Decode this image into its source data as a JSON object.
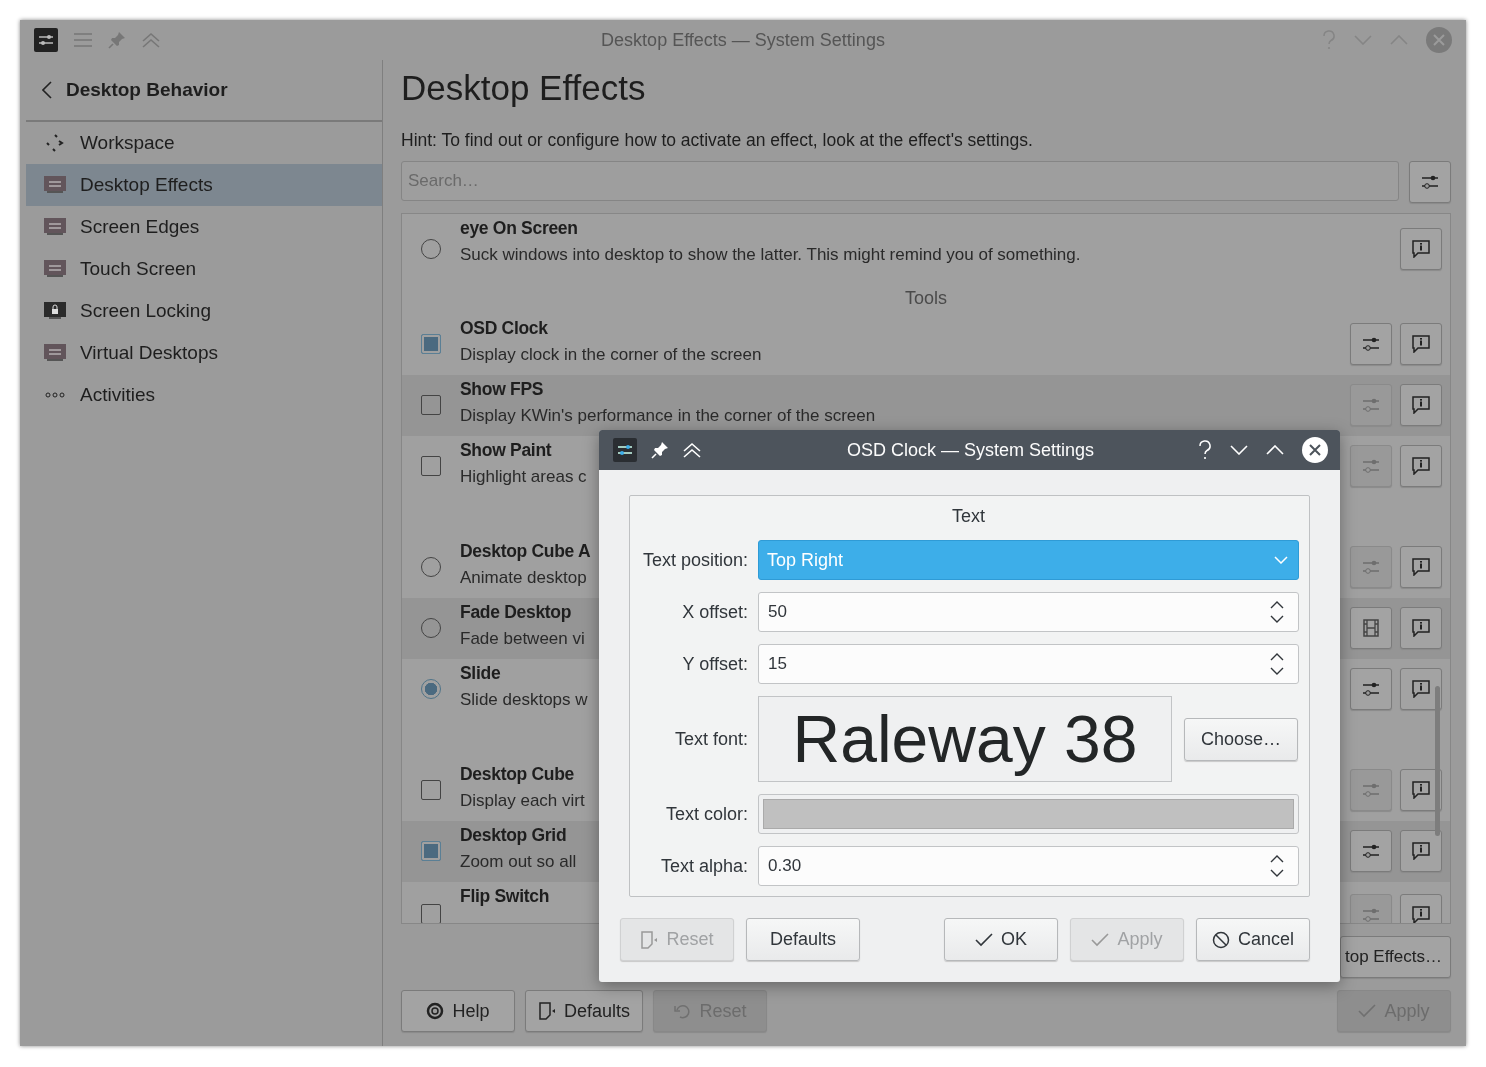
{
  "window": {
    "title": "Desktop Effects — System Settings"
  },
  "sidebar": {
    "header": "Desktop Behavior",
    "items": [
      {
        "label": "Workspace",
        "selected": false
      },
      {
        "label": "Desktop Effects",
        "selected": true
      },
      {
        "label": "Screen Edges",
        "selected": false
      },
      {
        "label": "Touch Screen",
        "selected": false
      },
      {
        "label": "Screen Locking",
        "selected": false
      },
      {
        "label": "Virtual Desktops",
        "selected": false
      },
      {
        "label": "Activities",
        "selected": false
      }
    ]
  },
  "page": {
    "title": "Desktop Effects",
    "hint": "Hint: To find out or configure how to activate an effect, look at the effect's settings.",
    "search": {
      "placeholder": "Search…"
    }
  },
  "effects": [
    {
      "kind": "radio",
      "checked": false,
      "title": "eye On Screen",
      "description": "Suck windows into desktop to show the latter. This might remind you of something."
    },
    {
      "kind": "section",
      "title": "Tools"
    },
    {
      "kind": "checkbox",
      "checked": true,
      "title": "OSD Clock",
      "description": "Display clock in the corner of the screen",
      "configure": {
        "kind": "settings",
        "enabled": true
      }
    },
    {
      "kind": "checkbox",
      "checked": false,
      "title": "Show FPS",
      "description": "Display KWin's performance in the corner of the screen",
      "configure": {
        "kind": "settings",
        "enabled": false
      }
    },
    {
      "kind": "checkbox",
      "checked": false,
      "title": "Show Paint",
      "description": "Highlight areas c",
      "configure": {
        "kind": "settings",
        "enabled": false
      }
    },
    {
      "kind": "spacer"
    },
    {
      "kind": "radio",
      "checked": false,
      "title": "Desktop Cube A",
      "description": "Animate desktop",
      "configure": {
        "kind": "settings",
        "enabled": false
      }
    },
    {
      "kind": "radio",
      "checked": false,
      "title": "Fade Desktop",
      "description": "Fade between vi",
      "configure": {
        "kind": "video",
        "enabled": true
      }
    },
    {
      "kind": "radio",
      "checked": true,
      "title": "Slide",
      "description": "Slide desktops w",
      "configure": {
        "kind": "settings",
        "enabled": true
      }
    },
    {
      "kind": "spacer"
    },
    {
      "kind": "checkbox",
      "checked": false,
      "title": "Desktop Cube",
      "description": "Display each virt",
      "configure": {
        "kind": "settings",
        "enabled": false
      }
    },
    {
      "kind": "checkbox",
      "checked": true,
      "title": "Desktop Grid",
      "description": "Zoom out so all",
      "configure": {
        "kind": "settings",
        "enabled": true
      }
    },
    {
      "kind": "checkbox",
      "checked": false,
      "title": "Flip Switch",
      "configure": {
        "kind": "settings",
        "enabled": false
      }
    }
  ],
  "get_new_button": "top Effects…",
  "footer_buttons": [
    {
      "label": "Help",
      "enabled": true
    },
    {
      "label": "Defaults",
      "enabled": true
    },
    {
      "label": "Reset",
      "enabled": false
    }
  ],
  "apply_button": {
    "label": "Apply",
    "enabled": false
  },
  "dialog": {
    "title": "OSD Clock — System Settings",
    "group_title": "Text",
    "fields": [
      {
        "kind": "combo",
        "label": "Text position:",
        "value": "Top Right"
      },
      {
        "kind": "spin",
        "label": "X offset:",
        "value": "50"
      },
      {
        "kind": "spin",
        "label": "Y offset:",
        "value": "15"
      },
      {
        "kind": "font",
        "label": "Text font:",
        "value": "Raleway 38",
        "button": "Choose…"
      },
      {
        "kind": "color",
        "label": "Text color:",
        "color": "#c0c0c0"
      },
      {
        "kind": "spin",
        "label": "Text alpha:",
        "value": "0.30"
      }
    ],
    "left_buttons": [
      {
        "label": "Reset",
        "enabled": false
      },
      {
        "label": "Defaults",
        "enabled": true
      }
    ],
    "right_buttons": [
      {
        "label": "OK",
        "enabled": true
      },
      {
        "label": "Apply",
        "enabled": false
      },
      {
        "label": "Cancel",
        "enabled": true
      }
    ]
  }
}
